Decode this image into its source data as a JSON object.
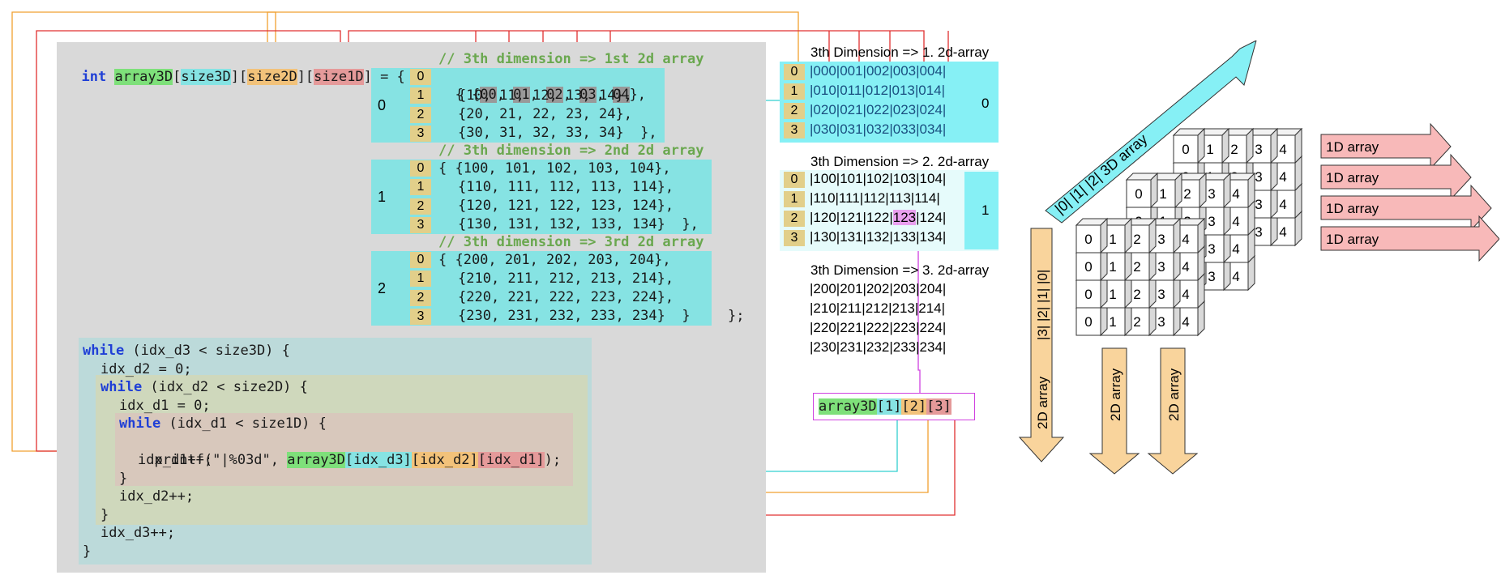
{
  "code": {
    "decl": {
      "type_kw": "int",
      "array_name": "array3D",
      "dim_3d": "size3D",
      "dim_2d": "size2D",
      "dim_1d": "size1D",
      "assign": " = {",
      "comment_1": "// 3th dimension => 1st 2d array",
      "comment_2": "// 3th dimension => 2nd 2d array",
      "comment_3": "// 3th dimension => 3rd 2d array"
    },
    "block_labels": [
      "0",
      "1",
      "2"
    ],
    "row_indices": [
      "0",
      "1",
      "2",
      "3"
    ],
    "block0": {
      "row0_open": "{ {",
      "row0_cells": [
        "00",
        "01",
        "02",
        "03",
        "04"
      ],
      "row0_close": "},",
      "row1": "{10, 11, 12, 13, 14},",
      "row2": "{20, 21, 22, 23, 24},",
      "row3": "{30, 31, 32, 33, 34}  },"
    },
    "block1": {
      "row0": "{ {100, 101, 102, 103, 104},",
      "row1": "{110, 111, 112, 113, 114},",
      "row2": "{120, 121, 122, 123, 124},",
      "row3": "{130, 131, 132, 133, 134}  },"
    },
    "block2": {
      "row0": "{ {200, 201, 202, 203, 204},",
      "row1": "{210, 211, 212, 213, 214},",
      "row2": "{220, 221, 222, 223, 224},",
      "row3": "{230, 231, 232, 233, 234}  }",
      "end": "};"
    },
    "loop": {
      "while_kw": "while",
      "while3": " (idx_d3 < size3D) {",
      "init2": "idx_d2 = 0;",
      "while2": " (idx_d2 < size2D) {",
      "init1": "idx_d1 = 0;",
      "while1": " (idx_d1 < size1D) {",
      "printf_pre": "printf(\"|%03d\", ",
      "pf_name": "array3D",
      "pf_d3": "[idx_d3]",
      "pf_d2": "[idx_d2]",
      "pf_d1": "[idx_d1]",
      "printf_post": ");",
      "inc1": "idx_d1++;",
      "close1": "}",
      "inc2": "idx_d2++;",
      "close2": "}",
      "inc3": "idx_d3++;",
      "close3": "}"
    }
  },
  "memory": {
    "title1": "3th Dimension => 1. 2d-array",
    "title2": "3th Dimension => 2. 2d-array",
    "title3": "3th Dimension => 3. 2d-array",
    "a1": [
      "|000|001|002|003|004|",
      "|010|011|012|013|014|",
      "|020|021|022|023|024|",
      "|030|031|032|033|034|"
    ],
    "a2_row0": "|100|101|102|103|104|",
    "a2_row1": "|110|111|112|113|114|",
    "a2_row2_pre": "|120|121|122|",
    "a2_row2_hl": "123",
    "a2_row2_post": "|124|",
    "a2_row3": "|130|131|132|133|134|",
    "a3": [
      "|200|201|202|203|204|",
      "|210|211|212|213|214|",
      "|220|221|222|223|224|",
      "|230|231|232|233|234|"
    ],
    "side_label_1": "0",
    "side_label_2": "1",
    "access": {
      "name": "array3D",
      "i3": "[1]",
      "i2": "[2]",
      "i1": "[3]"
    }
  },
  "cube": {
    "cells": [
      "0",
      "1",
      "2",
      "3",
      "4"
    ],
    "arrow_3d": "|0|      |1|       |2|   3D array",
    "arrow_2d_vertical": "|3| |2| |1| |0|",
    "label_2d": "2D array",
    "label_1d": "1D array",
    "partial_digit": "3",
    "partial_digit_4": "4"
  },
  "colors": {
    "cyan": "#86e3e3",
    "green": "#7ee07a",
    "orange": "#f2c27a",
    "red": "#e59a9a",
    "grey_panel": "#d9d9d9",
    "tan": "#e2cf8a",
    "pink": "#e9a0ef",
    "pink_arrow": "#f8b9b9",
    "orange_arrow": "#f9d49c"
  }
}
